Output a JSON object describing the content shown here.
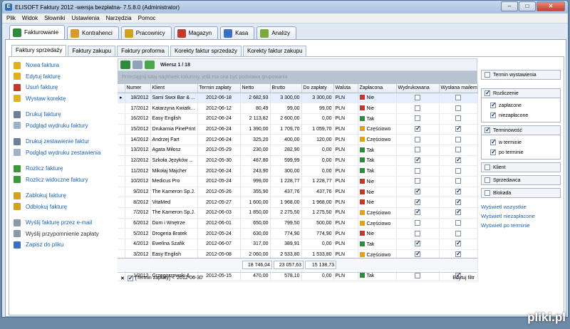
{
  "window": {
    "title": "ELISOFT Faktury 2012 -wersja bezpłatna- 7.5.8.0  (Administrator)",
    "minimize": "–",
    "maximize": "□",
    "close": "✕"
  },
  "menu": [
    "Plik",
    "Widok",
    "Słowniki",
    "Ustawienia",
    "Narzędzia",
    "Pomoc"
  ],
  "main_tabs": [
    {
      "label": "Fakturowanie",
      "color": "#2e8b3e"
    },
    {
      "label": "Kontrahenci",
      "color": "#d89a2a"
    },
    {
      "label": "Pracownicy",
      "color": "#d4a020"
    },
    {
      "label": "Magazyn",
      "color": "#c0392b"
    },
    {
      "label": "Kasa",
      "color": "#3a6fc4"
    },
    {
      "label": "Analizy",
      "color": "#7aa83a"
    }
  ],
  "sub_tabs": [
    "Faktury sprzedaży",
    "Faktury zakupu",
    "Faktury proforma",
    "Korekty faktur sprzedaży",
    "Korekty faktur zakupu"
  ],
  "left_nav": [
    [
      {
        "label": "Nowa faktura",
        "color": "#e0b020"
      },
      {
        "label": "Edytuj fakturę",
        "color": "#e0b020"
      },
      {
        "label": "Usuń fakturę",
        "color": "#c0392b"
      },
      {
        "label": "Wystaw korektę",
        "color": "#e0b020"
      }
    ],
    [
      {
        "label": "Drukuj fakturę",
        "color": "#6b7f99"
      },
      {
        "label": "Podgląd wydruku faktury",
        "color": "#9fb2c8"
      }
    ],
    [
      {
        "label": "Drukuj zestawienie faktur",
        "color": "#6b7f99"
      },
      {
        "label": "Podgląd wydruku zestawienia",
        "color": "#9fb2c8"
      }
    ],
    [
      {
        "label": "Rozlicz fakturę",
        "color": "#3a9a3a"
      },
      {
        "label": "Rozlicz widoczne faktury",
        "color": "#3a9a3a"
      }
    ],
    [
      {
        "label": "Zablokuj fakturę",
        "color": "#d4a020"
      },
      {
        "label": "Odblokuj fakturę",
        "color": "#d4a020"
      }
    ],
    [
      {
        "label": "Wyślij fakturę przez e-mail",
        "color": "#8a98aa",
        "gray": false
      },
      {
        "label": "Wyślij przypomnienie zapłaty",
        "color": "#8a98aa",
        "gray": true
      },
      {
        "label": "Zapisz do pliku",
        "color": "#3a6fc4",
        "gray": false
      }
    ]
  ],
  "toolbar": {
    "row_label": "Wiersz 1 / 18"
  },
  "group_hint": "Przeciągnij tutaj nagłówek kolumny, jeśli ma ona być podstawą grupowania",
  "columns": [
    "Numer",
    "Klient",
    "Termin zapłaty",
    "Netto",
    "Brutto",
    "Do zapłaty",
    "Waluta",
    "Zapłacona",
    "Wydrukowana",
    "Wysłana mailem"
  ],
  "rows": [
    {
      "numer": "18/2012",
      "klient": "Sami Swoi Bar & ...",
      "termin": "2012-06-18",
      "netto": "2 682,93",
      "brutto": "3 300,00",
      "dozap": "3 300,00",
      "waluta": "PLN",
      "status": "Nie",
      "scolor": "#c0392b",
      "wyd": false,
      "mail": false
    },
    {
      "numer": "17/2012",
      "klient": "Katarzyna Kwiatk...",
      "termin": "2012-06-12",
      "netto": "80,49",
      "brutto": "99,00",
      "dozap": "99,00",
      "waluta": "PLN",
      "status": "Nie",
      "scolor": "#c0392b",
      "wyd": false,
      "mail": false
    },
    {
      "numer": "16/2012",
      "klient": "Easy English",
      "termin": "2012-06-24",
      "netto": "2 113,82",
      "brutto": "2 600,00",
      "dozap": "0,00",
      "waluta": "PLN",
      "status": "Tak",
      "scolor": "#2e8b3e",
      "wyd": false,
      "mail": false
    },
    {
      "numer": "15/2012",
      "klient": "Drukarnia PinePrint",
      "termin": "2012-06-24",
      "netto": "1 390,00",
      "brutto": "1 709,70",
      "dozap": "1 059,70",
      "waluta": "PLN",
      "status": "Częściowo",
      "scolor": "#e0a020",
      "wyd": true,
      "mail": true
    },
    {
      "numer": "14/2012",
      "klient": "Andrzej Fart",
      "termin": "2012-06-24",
      "netto": "325,20",
      "brutto": "400,00",
      "dozap": "120,00",
      "waluta": "PLN",
      "status": "Częściowo",
      "scolor": "#e0a020",
      "wyd": false,
      "mail": false
    },
    {
      "numer": "13/2012",
      "klient": "Agata Miłosz",
      "termin": "2012-05-29",
      "netto": "230,00",
      "brutto": "282,90",
      "dozap": "0,00",
      "waluta": "PLN",
      "status": "Tak",
      "scolor": "#2e8b3e",
      "wyd": false,
      "mail": false
    },
    {
      "numer": "12/2012",
      "klient": "Szkoła Języków ...",
      "termin": "2012-05-30",
      "netto": "487,80",
      "brutto": "599,99",
      "dozap": "0,00",
      "waluta": "PLN",
      "status": "Tak",
      "scolor": "#2e8b3e",
      "wyd": true,
      "mail": true
    },
    {
      "numer": "11/2012",
      "klient": "Mikołaj Majcher",
      "termin": "2012-06-24",
      "netto": "243,90",
      "brutto": "300,00",
      "dozap": "0,00",
      "waluta": "PLN",
      "status": "Tak",
      "scolor": "#2e8b3e",
      "wyd": false,
      "mail": false
    },
    {
      "numer": "10/2012",
      "klient": "Medicus Pro",
      "termin": "2012-05-24",
      "netto": "999,00",
      "brutto": "1 228,77",
      "dozap": "1 228,77",
      "waluta": "PLN",
      "status": "Nie",
      "scolor": "#c0392b",
      "wyd": false,
      "mail": false
    },
    {
      "numer": "9/2012",
      "klient": "The Kameron Sp.J.",
      "termin": "2012-05-26",
      "netto": "355,90",
      "brutto": "437,76",
      "dozap": "437,76",
      "waluta": "PLN",
      "status": "Nie",
      "scolor": "#c0392b",
      "wyd": true,
      "mail": true
    },
    {
      "numer": "8/2012",
      "klient": "VitaMed",
      "termin": "2012-05-27",
      "netto": "1 600,00",
      "brutto": "1 968,00",
      "dozap": "1 968,00",
      "waluta": "PLN",
      "status": "Nie",
      "scolor": "#c0392b",
      "wyd": true,
      "mail": true
    },
    {
      "numer": "7/2012",
      "klient": "The Kameron Sp.J.",
      "termin": "2012-06-03",
      "netto": "1 850,00",
      "brutto": "2 275,50",
      "dozap": "1 275,50",
      "waluta": "PLN",
      "status": "Częściowo",
      "scolor": "#e0a020",
      "wyd": true,
      "mail": true
    },
    {
      "numer": "6/2012",
      "klient": "Dom i Wnętrze",
      "termin": "2012-06-01",
      "netto": "650,00",
      "brutto": "799,50",
      "dozap": "500,00",
      "waluta": "PLN",
      "status": "Częściowo",
      "scolor": "#e0a020",
      "wyd": false,
      "mail": false
    },
    {
      "numer": "5/2012",
      "klient": "Drogeria Bratek",
      "termin": "2012-05-24",
      "netto": "630,00",
      "brutto": "774,90",
      "dozap": "774,90",
      "waluta": "PLN",
      "status": "Nie",
      "scolor": "#c0392b",
      "wyd": false,
      "mail": false
    },
    {
      "numer": "4/2012",
      "klient": "Ewelina Szafik",
      "termin": "2012-06-07",
      "netto": "317,00",
      "brutto": "389,91",
      "dozap": "0,00",
      "waluta": "PLN",
      "status": "Tak",
      "scolor": "#2e8b3e",
      "wyd": true,
      "mail": true
    },
    {
      "numer": "3/2012",
      "klient": "Easy English",
      "termin": "2012-05-08",
      "netto": "2 060,00",
      "brutto": "2 533,80",
      "dozap": "1 533,80",
      "waluta": "PLN",
      "status": "Częściowo",
      "scolor": "#e0a020",
      "wyd": true,
      "mail": true
    },
    {
      "numer": "2/2012",
      "klient": "Sebastian Szczygło",
      "termin": "2012-05-03",
      "netto": "2 310,00",
      "brutto": "2 841,30",
      "dozap": "2 841,30",
      "waluta": "PLN",
      "status": "Nie",
      "scolor": "#c0392b",
      "wyd": true,
      "mail": true
    },
    {
      "numer": "1/2012",
      "klient": "Grzegorzewski & ...",
      "termin": "2012-05-15",
      "netto": "470,00",
      "brutto": "578,10",
      "dozap": "0,00",
      "waluta": "PLN",
      "status": "Tak",
      "scolor": "#2e8b3e",
      "wyd": false,
      "mail": true
    }
  ],
  "sums": {
    "netto": "18 746,04",
    "brutto": "23 057,63",
    "dozap": "15 138,73"
  },
  "filter": {
    "text": "[Termin zapłaty] < '2012-06-30'",
    "edit": "Edytuj filtr"
  },
  "right": {
    "termin_wystawienia": "Termin wystawienia",
    "rozliczenie": {
      "label": "Rozliczenie",
      "opts": [
        "zapłacone",
        "niezapłacone"
      ]
    },
    "terminowosc": {
      "label": "Terminowość",
      "opts": [
        "w terminie",
        "po terminie"
      ]
    },
    "klient": "Klient",
    "sprzedawca": "Sprzedawca",
    "blokada": "Blokada",
    "links": [
      "Wyświetl wszystkie",
      "Wyświetl niezapłacone",
      "Wyświetl po terminie"
    ]
  },
  "watermark": "pliki.pl"
}
